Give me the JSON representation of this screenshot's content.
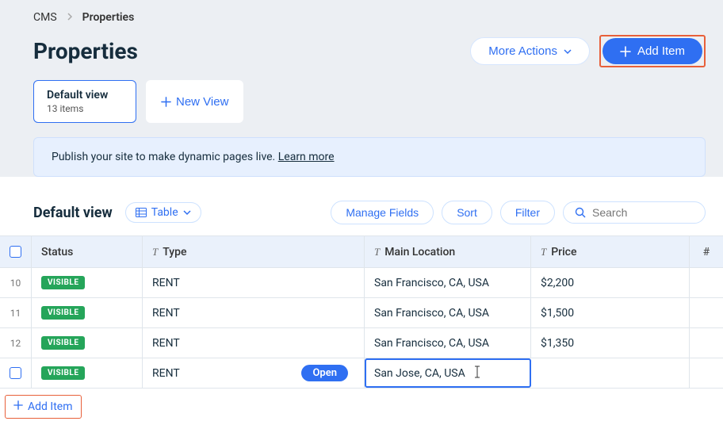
{
  "breadcrumb": {
    "root": "CMS",
    "current": "Properties"
  },
  "page": {
    "title": "Properties"
  },
  "header_actions": {
    "more": "More Actions",
    "add_item": "Add Item"
  },
  "views": {
    "active": {
      "name": "Default view",
      "count_label": "13 items"
    },
    "new_view_label": "New View"
  },
  "notice": {
    "text": "Publish your site to make dynamic pages live. ",
    "link": "Learn more"
  },
  "toolbar": {
    "title": "Default view",
    "view_mode": "Table",
    "manage_fields": "Manage Fields",
    "sort": "Sort",
    "filter": "Filter",
    "search_placeholder": "Search"
  },
  "columns": {
    "status": "Status",
    "type": "Type",
    "location": "Main Location",
    "price": "Price",
    "extra": "#"
  },
  "rows": [
    {
      "num": "10",
      "status": "VISIBLE",
      "type": "RENT",
      "location": "San Francisco, CA, USA",
      "price": "$2,200",
      "editing": false,
      "show_open": false,
      "checkbox_numbered": true
    },
    {
      "num": "11",
      "status": "VISIBLE",
      "type": "RENT",
      "location": "San Francisco, CA, USA",
      "price": "$1,500",
      "editing": false,
      "show_open": false,
      "checkbox_numbered": true
    },
    {
      "num": "12",
      "status": "VISIBLE",
      "type": "RENT",
      "location": "San Francisco, CA, USA",
      "price": "$1,350",
      "editing": false,
      "show_open": false,
      "checkbox_numbered": true
    },
    {
      "num": "",
      "status": "VISIBLE",
      "type": "RENT",
      "location": "San Jose, CA, USA",
      "price": "",
      "editing": true,
      "show_open": true,
      "checkbox_numbered": false
    }
  ],
  "open_label": "Open",
  "footer": {
    "add_item": "Add Item"
  }
}
